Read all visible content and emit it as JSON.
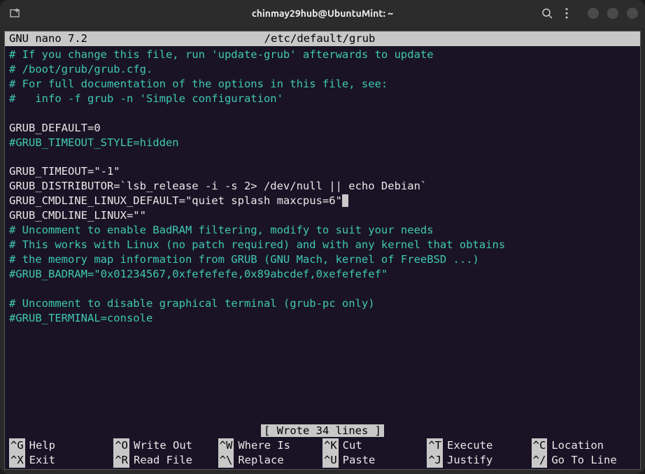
{
  "titlebar": {
    "title": "chinmay29hub@UbuntuMint: ~"
  },
  "nano": {
    "app": "  GNU nano 7.2",
    "filename": "/etc/default/grub",
    "status": "[ Wrote 34 lines ]"
  },
  "lines": [
    {
      "cls": "comment",
      "text": "# If you change this file, run 'update-grub' afterwards to update"
    },
    {
      "cls": "comment",
      "text": "# /boot/grub/grub.cfg."
    },
    {
      "cls": "comment",
      "text": "# For full documentation of the options in this file, see:"
    },
    {
      "cls": "comment",
      "text": "#   info -f grub -n 'Simple configuration'"
    },
    {
      "cls": "plain",
      "text": ""
    },
    {
      "cls": "plain",
      "text": "GRUB_DEFAULT=0"
    },
    {
      "cls": "comment",
      "text": "#GRUB_TIMEOUT_STYLE=hidden"
    },
    {
      "cls": "plain",
      "text": ""
    },
    {
      "cls": "plain",
      "text": "GRUB_TIMEOUT=\"-1\""
    },
    {
      "cls": "plain",
      "text": "GRUB_DISTRIBUTOR=`lsb_release -i -s 2> /dev/null || echo Debian`"
    },
    {
      "cls": "plain",
      "text": "GRUB_CMDLINE_LINUX_DEFAULT=\"quiet splash maxcpus=6\"",
      "cursor": true
    },
    {
      "cls": "plain",
      "text": "GRUB_CMDLINE_LINUX=\"\""
    },
    {
      "cls": "comment",
      "text": "# Uncomment to enable BadRAM filtering, modify to suit your needs"
    },
    {
      "cls": "comment",
      "text": "# This works with Linux (no patch required) and with any kernel that obtains"
    },
    {
      "cls": "comment",
      "text": "# the memory map information from GRUB (GNU Mach, kernel of FreeBSD ...)"
    },
    {
      "cls": "comment",
      "text": "#GRUB_BADRAM=\"0x01234567,0xfefefefe,0x89abcdef,0xefefefef\""
    },
    {
      "cls": "plain",
      "text": ""
    },
    {
      "cls": "comment",
      "text": "# Uncomment to disable graphical terminal (grub-pc only)"
    },
    {
      "cls": "comment",
      "text": "#GRUB_TERMINAL=console"
    },
    {
      "cls": "plain",
      "text": ""
    }
  ],
  "shortcuts": [
    {
      "key": "^G",
      "label": "Help"
    },
    {
      "key": "^O",
      "label": "Write Out"
    },
    {
      "key": "^W",
      "label": "Where Is"
    },
    {
      "key": "^K",
      "label": "Cut"
    },
    {
      "key": "^T",
      "label": "Execute"
    },
    {
      "key": "^C",
      "label": "Location"
    },
    {
      "key": "^X",
      "label": "Exit"
    },
    {
      "key": "^R",
      "label": "Read File"
    },
    {
      "key": "^\\",
      "label": "Replace"
    },
    {
      "key": "^U",
      "label": "Paste"
    },
    {
      "key": "^J",
      "label": "Justify"
    },
    {
      "key": "^/",
      "label": "Go To Line"
    }
  ]
}
